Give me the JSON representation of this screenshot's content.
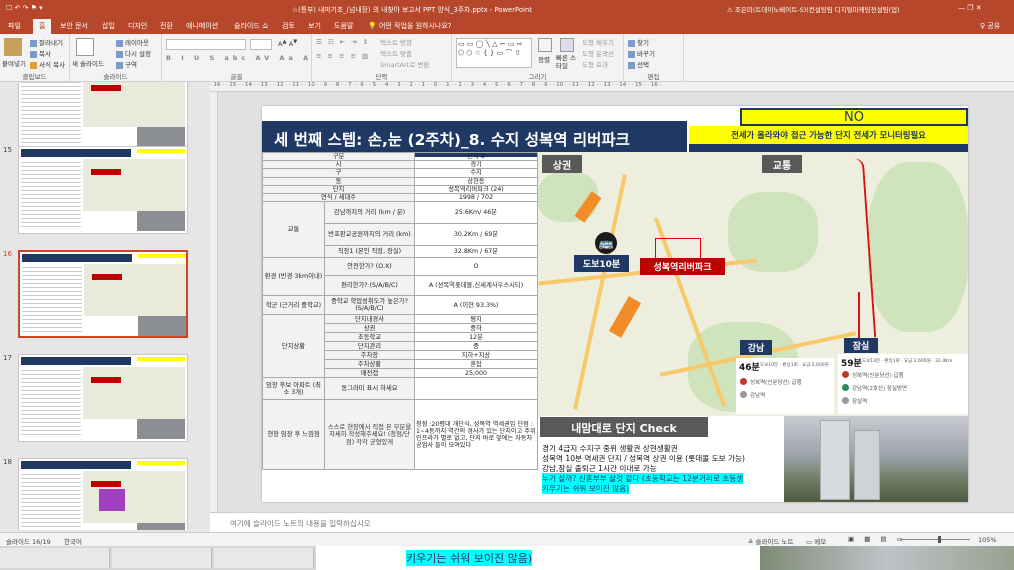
{
  "title": {
    "quick_access": "☐ ↶ ↷ ⚑ ▾",
    "doc": "☆(통부) 내마기초_(넘내장) 의 내찾아 보고서 PPT 양식_3주차.pptx - PowerPoint",
    "warning": "⚠ 조은미(트데이노베이트-S)(컨설팅팀 디지털마케팅전설팀(업)",
    "win": "—  ❐  ✕"
  },
  "tabs": [
    "파일",
    "홈",
    "보안 문서",
    "삽입",
    "디자인",
    "전환",
    "애니메이션",
    "슬라이드 쇼",
    "검토",
    "보기",
    "도움말"
  ],
  "tell_me": "💡 어떤 작업을 원하시나요?",
  "share": "♀ 공유",
  "ribbon": {
    "clipboard": {
      "label": "클립보드",
      "paste": "붙여넣기",
      "cut": "잘라내기",
      "copy": "복사",
      "format": "서식 복사"
    },
    "slides": {
      "label": "슬라이드",
      "new": "새 슬라이드",
      "layout": "레이아웃",
      "reset": "다시 설정",
      "section": "구역"
    },
    "font_label": "글꼴",
    "paragraph_label": "단락",
    "text_dir": "텍스트 방향",
    "align_text": "텍스트 맞춤",
    "smartart": "SmartArt로 변환",
    "drawing_label": "그리기",
    "arrange": "정렬",
    "quick_styles": "빠른 스타일",
    "fill": "도형 채우기",
    "outline": "도형 윤곽선",
    "effects": "도형 효과",
    "editing_label": "편집",
    "find": "찾기",
    "replace": "바꾸기",
    "select": "선택"
  },
  "ruler": "· 16 · · 15 · · 14 · · 13 · · 12 · · 11 · · 10 · · 9 · · 8 · · 7 · · 6 · · 5 · · 4 · · 3 · · 2 · · 1 · · 0 · · 1 · · 2 · · 3 · · 4 · · 5 · · 6 · · 7 · · 8 · · 9 · · 10 · · 11 · · 12 · · 13 · · 14 · · 15 · · 16 ·",
  "thumb_numbers": [
    "15",
    "16",
    "17",
    "18"
  ],
  "slide": {
    "title": "세 번째 스텝: 손,눈 (2주차)_8. 수지 성복역 리버파크",
    "no_label": "NO",
    "subtitle": "전세가 올라와야 접근 가능한 단지 전세가 모니터링필요",
    "table": {
      "gubun": "구분",
      "gubun_v": "단지 8",
      "si": "시",
      "si_v": "경기",
      "gu": "구",
      "gu_v": "수지",
      "dong": "동",
      "dong_v": "상현동",
      "danji": "단지",
      "danji_v": "성복역리버파크 (24)",
      "year": "연식 / 세대수",
      "year_v": "1998 / 702",
      "traffic": "교통",
      "gn_time": "강남까지의 거리 (km / 분)",
      "gn_time_v": "25.6Km/ 46분",
      "pg_time": "반포판교공원까지의 거리 (km)",
      "pg_time_v": "30.2Km / 69분",
      "job_time": "직장1 (본인 직장, 장실)",
      "job_time_v": "32.8Km / 67분",
      "env": "환경 (반경 3km이내)",
      "safe": "안전한가? (O.X)",
      "safe_v": "O",
      "conv": "편리한가? (S/A/B/C)",
      "conv_v": "A (성복역롯데몰,신세계사우스시티)",
      "school_grp": "학군 (근거리 중학교)",
      "school": "중학교 학업성취도가 높은가? (S/A/B/C)",
      "school_v": "A (이현 93.3%)",
      "complex": "단지상황",
      "terrain": "단지내경사",
      "terrain_v": "평지",
      "shop": "상권",
      "shop_v": "중하",
      "elem": "초등학교",
      "elem_v": "12분",
      "mgmt": "단지관리",
      "mgmt_v": "중",
      "parking": "주차장",
      "parking_v": "지하+지상",
      "parkstat": "주차상황",
      "parkstat_v": "혼잡",
      "price": "매전갭",
      "price_v": "25,000",
      "cand": "임장 후보 아파트 (최소 3개)",
      "cand_v": "동그라미 표시 하세요",
      "impress": "현장 임장 후 느낌점",
      "impress_q": "스스로 현장에서 직접 본 부분을 자세히 작성해주세요! (청점/단점) 각각 균형있게",
      "impress_v": "청점 :20평대 개단식, 성복역 역세권임 단점 : 1~4동까지 역간의 경사가 있는 단지이고 주위 인프라가 별로 없고, 단지 바로 앞에는 자동차 공업사 들이 모여있다"
    },
    "map": {
      "sangwon": "상권",
      "gyotong": "교통",
      "bus": "🚌",
      "walk": "도보10분",
      "apt": "성복역리버파크",
      "gangnam": "강남",
      "jamsil": "잠실"
    },
    "panels": {
      "gn_min": "46분",
      "gn_detail": "도보10분 · 환승1회 · 요금 2,600원 · 25.6Km",
      "gn_st1": "성복역(신분당선) 급행",
      "gn_st2": "강남역",
      "js_min": "59분",
      "js_detail": "도보13분 · 환승1회 · 요금 2,600원 · 32.4Km",
      "js_st1": "성복역(신분당선) 급행",
      "js_st2": "강남역(2호선) 잠실방면",
      "js_st3": "잠실역"
    },
    "check": {
      "title": "내맘대로 단지 Check",
      "l1": "경기 4급지 수지구 중위 생활권 상현생활권",
      "l2": "성복역 10분 역세권 단지 / 성복역 상권 이용 (롯데몰 도보 가능)",
      "l3": "강남,잠실 출퇴근 1시간 이내로 가능",
      "l4": "누가 살까? 신혼부부 살것 같다 (초등학교는 12분거리로 초등생",
      "l5": "키우기는 쉬워 보이진 않음)"
    }
  },
  "notes_placeholder": "여기에 슬라이드 노트의 내용을 입력하십시오",
  "status": {
    "slide": "슬라이드 16/19",
    "lang": "한국어",
    "notes": "≙ 슬라이드 노트",
    "comments": "▭ 메모",
    "zoom": "105%"
  },
  "taskbar": {
    "preview": "키우기는 쉬워 보이진 않음)"
  },
  "colors": {
    "accent": "#b7472a",
    "navy": "#1f3864",
    "yellow": "#ffff00",
    "red": "#c00000"
  }
}
